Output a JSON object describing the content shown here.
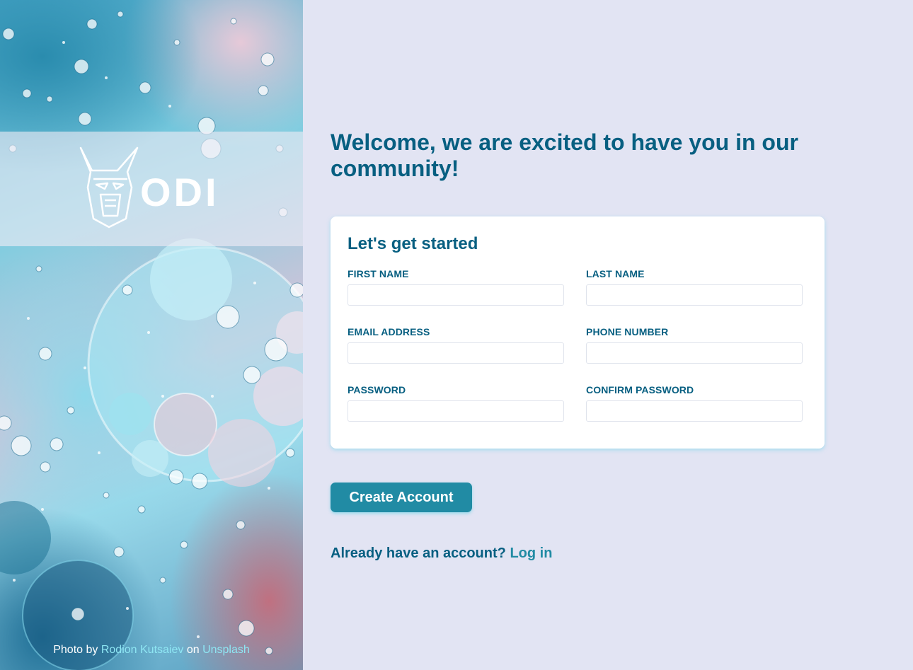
{
  "hero": {
    "logo_text": "ODIN",
    "credit": {
      "prefix": "Photo by",
      "author": "Rodion Kutsaiev",
      "middle": "on",
      "site": "Unsplash"
    }
  },
  "main": {
    "welcome": "Welcome, we are excited to have you in our community!",
    "form": {
      "title": "Let's get started",
      "fields": [
        {
          "label": "FIRST NAME",
          "value": ""
        },
        {
          "label": "LAST NAME",
          "value": ""
        },
        {
          "label": "EMAIL ADDRESS",
          "value": ""
        },
        {
          "label": "PHONE NUMBER",
          "value": ""
        },
        {
          "label": "PASSWORD",
          "value": ""
        },
        {
          "label": "CONFIRM PASSWORD",
          "value": ""
        }
      ]
    },
    "create_button": "Create Account",
    "login_prompt": "Already have an account?",
    "login_link": "Log in"
  },
  "colors": {
    "background": "#e2e4f3",
    "heading": "#075f81",
    "accent": "#218ba4",
    "link_light": "#8ee6f3"
  },
  "icons": {
    "logo": "odin-viking-helmet-icon"
  }
}
